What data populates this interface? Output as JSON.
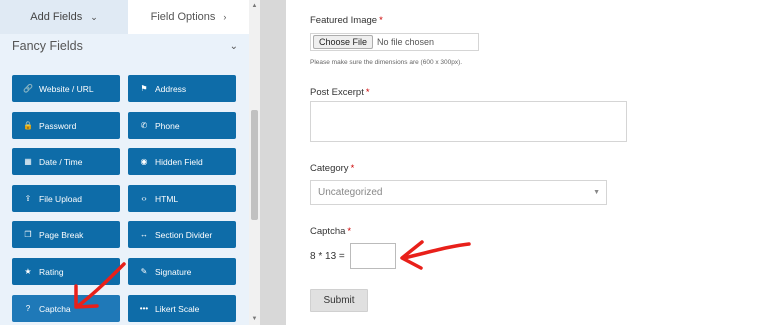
{
  "tabs": {
    "add_fields": "Add Fields",
    "field_options": "Field Options"
  },
  "section": {
    "title": "Fancy Fields"
  },
  "fields": [
    {
      "label": "Website / URL",
      "icon": "link-icon",
      "glyph": "🔗"
    },
    {
      "label": "Address",
      "icon": "map-marker-icon",
      "glyph": "⚑"
    },
    {
      "label": "Password",
      "icon": "lock-icon",
      "glyph": "🔒"
    },
    {
      "label": "Phone",
      "icon": "phone-icon",
      "glyph": "✆"
    },
    {
      "label": "Date / Time",
      "icon": "calendar-icon",
      "glyph": "▦"
    },
    {
      "label": "Hidden Field",
      "icon": "eye-slash-icon",
      "glyph": "◉"
    },
    {
      "label": "File Upload",
      "icon": "upload-icon",
      "glyph": "⇪"
    },
    {
      "label": "HTML",
      "icon": "code-icon",
      "glyph": "‹›"
    },
    {
      "label": "Page Break",
      "icon": "copy-icon",
      "glyph": "❐"
    },
    {
      "label": "Section Divider",
      "icon": "arrows-h-icon",
      "glyph": "↔"
    },
    {
      "label": "Rating",
      "icon": "star-icon",
      "glyph": "★"
    },
    {
      "label": "Signature",
      "icon": "pencil-icon",
      "glyph": "✎"
    },
    {
      "label": "Captcha",
      "icon": "question-circle-icon",
      "glyph": "?"
    },
    {
      "label": "Likert Scale",
      "icon": "ellipsis-icon",
      "glyph": "•••"
    }
  ],
  "form": {
    "featured_image": {
      "label": "Featured Image",
      "required": "*",
      "button": "Choose File",
      "status": "No file chosen",
      "hint": "Please make sure the dimensions are (600 x 300px)."
    },
    "post_excerpt": {
      "label": "Post Excerpt",
      "required": "*",
      "value": ""
    },
    "category": {
      "label": "Category",
      "required": "*",
      "value": "Uncategorized"
    },
    "captcha": {
      "label": "Captcha",
      "required": "*",
      "question": "8 * 13 =",
      "value": ""
    },
    "submit": "Submit"
  },
  "colors": {
    "button_blue": "#0e6ca8",
    "panel_bg": "#eaf2fa",
    "annotation_arrow": "#e8201a",
    "required": "#cc0000"
  }
}
